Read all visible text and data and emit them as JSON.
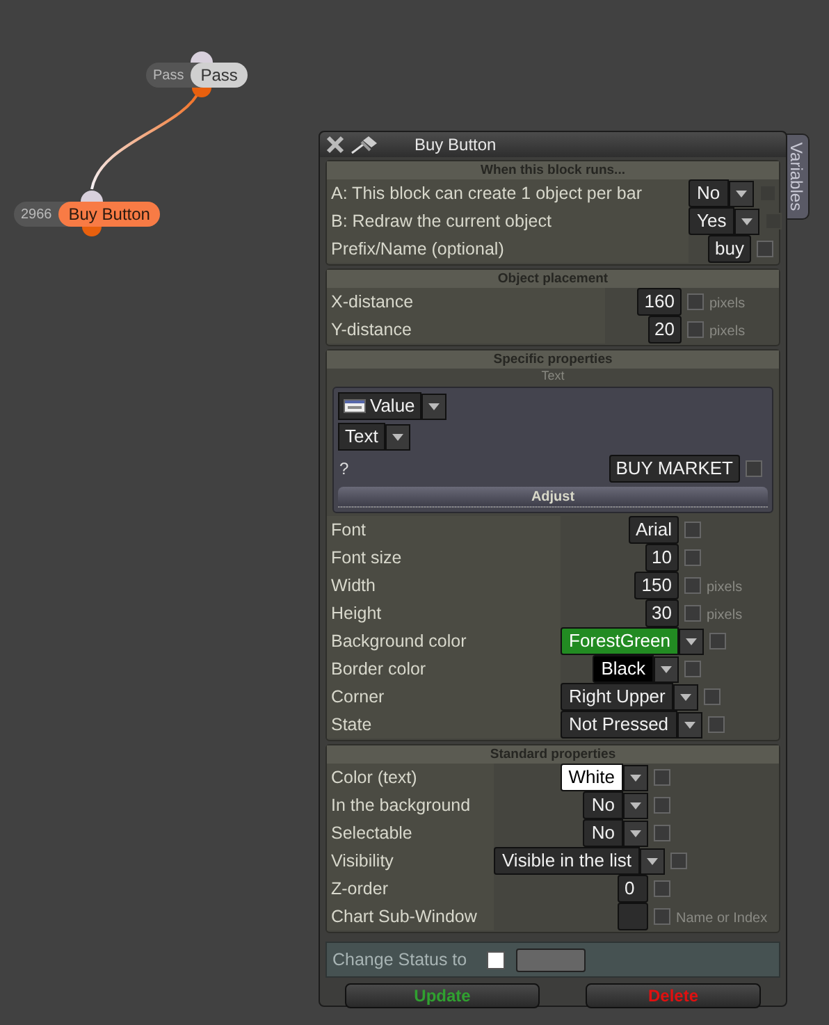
{
  "nodes": [
    {
      "count": "Pass",
      "label": "Pass",
      "selected": false
    },
    {
      "count": "2966",
      "label": "Buy Button",
      "selected": true
    }
  ],
  "panel": {
    "title": "Buy Button",
    "side_tab": "Variables",
    "sections": [
      {
        "title": "When this block runs...",
        "rows": [
          {
            "kind": "dropdown",
            "label": "A: This block can create 1 object per bar",
            "value": "No",
            "checked": false,
            "disabled": true
          },
          {
            "kind": "dropdown",
            "label": "B: Redraw the current object",
            "value": "Yes",
            "checked": false,
            "disabled": true
          },
          {
            "kind": "input",
            "label": "Prefix/Name (optional)",
            "value": "buy",
            "checked": false,
            "disabled": false
          }
        ]
      },
      {
        "title": "Object placement",
        "rows": [
          {
            "kind": "input",
            "label": "X-distance",
            "value": "160",
            "checked": false,
            "disabled": false,
            "unit": "pixels"
          },
          {
            "kind": "input",
            "label": "Y-distance",
            "value": "20",
            "checked": false,
            "disabled": false,
            "unit": "pixels"
          }
        ]
      },
      {
        "title": "Specific properties",
        "subtitle": "Text",
        "text_box": {
          "source": "Value",
          "type": "Text",
          "hint": "?",
          "value": "BUY MARKET",
          "checked": false,
          "button": "Adjust"
        },
        "rows": [
          {
            "kind": "input",
            "label": "Font",
            "value": "Arial",
            "checked": false,
            "disabled": false
          },
          {
            "kind": "input",
            "label": "Font size",
            "value": "10",
            "checked": false,
            "disabled": false
          },
          {
            "kind": "input",
            "label": "Width",
            "value": "150",
            "checked": false,
            "disabled": false,
            "unit": "pixels"
          },
          {
            "kind": "input",
            "label": "Height",
            "value": "30",
            "checked": false,
            "disabled": false,
            "unit": "pixels"
          },
          {
            "kind": "color",
            "label": "Background color",
            "value": "ForestGreen",
            "color": "#228b22",
            "checked": false,
            "disabled": false
          },
          {
            "kind": "color",
            "label": "Border color",
            "value": "Black",
            "color": "#000000",
            "checked": false,
            "disabled": false
          },
          {
            "kind": "dropdown",
            "label": "Corner",
            "value": "Right Upper",
            "checked": false,
            "disabled": false
          },
          {
            "kind": "dropdown",
            "label": "State",
            "value": "Not Pressed",
            "checked": false,
            "disabled": false
          }
        ]
      },
      {
        "title": "Standard properties",
        "rows": [
          {
            "kind": "color",
            "label": "Color (text)",
            "value": "White",
            "color": "#ffffff",
            "checked": false,
            "disabled": false
          },
          {
            "kind": "dropdown",
            "label": "In the background",
            "value": "No",
            "checked": false,
            "disabled": false
          },
          {
            "kind": "dropdown",
            "label": "Selectable",
            "value": "No",
            "checked": false,
            "disabled": false
          },
          {
            "kind": "dropdown",
            "label": "Visibility",
            "value": "Visible in the list",
            "checked": false,
            "disabled": false
          },
          {
            "kind": "input",
            "label": "Z-order",
            "value": "0",
            "checked": false,
            "disabled": false
          },
          {
            "kind": "input",
            "label": "Chart Sub-Window",
            "checked": false,
            "disabled": false,
            "unit": "Name or Index"
          }
        ]
      }
    ],
    "status": {
      "label": "Change Status to",
      "checked": false
    },
    "buttons": [
      {
        "kind": "update",
        "label": "Update"
      },
      {
        "kind": "delete",
        "label": "Delete"
      }
    ]
  }
}
